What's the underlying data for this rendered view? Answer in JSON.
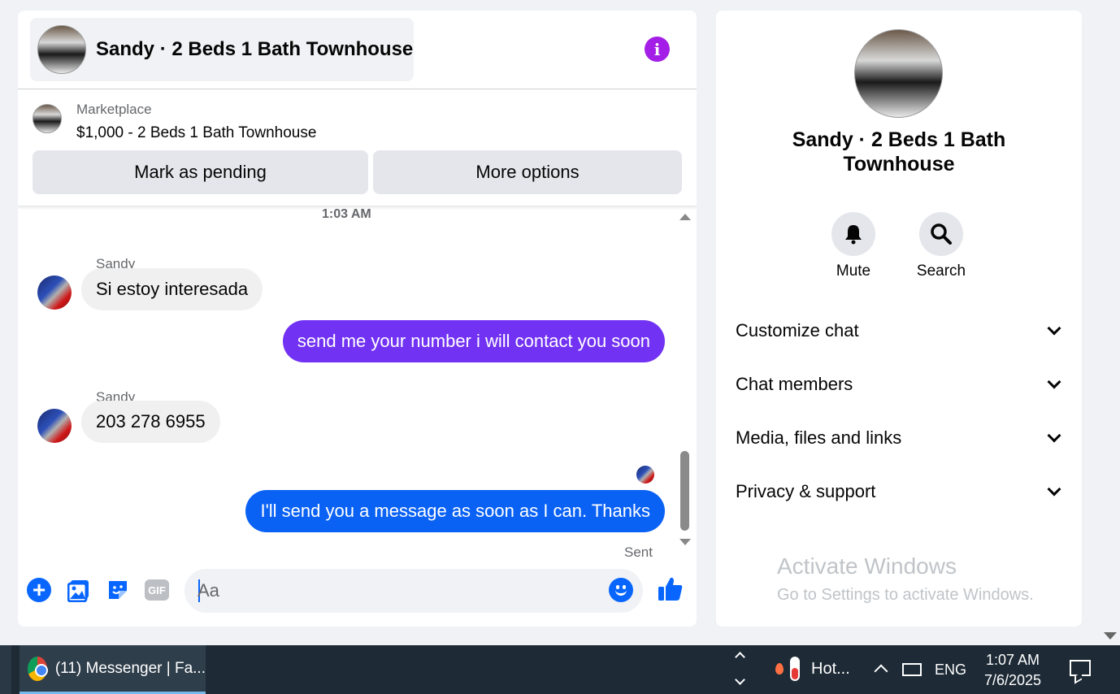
{
  "header": {
    "title": "Sandy · 2 Beds 1 Bath Townhouse",
    "info_glyph": "i"
  },
  "marketplace": {
    "label": "Marketplace",
    "listing": "$1,000 - 2 Beds 1 Bath Townhouse",
    "pending_button": "Mark as pending",
    "more_button": "More options"
  },
  "messages": {
    "timestamp": "1:03 AM",
    "items": [
      {
        "sender": "Sandy",
        "direction": "in",
        "text": "Si estoy interesada"
      },
      {
        "direction": "out",
        "text": "send me your number i will contact you soon",
        "color": "#7232f3"
      },
      {
        "sender": "Sandy",
        "direction": "in",
        "text": "203 278 6955"
      },
      {
        "direction": "out",
        "text": "I'll send you a message as soon as I can. Thanks",
        "color": "#0a62f5"
      }
    ],
    "status": "Sent"
  },
  "composer": {
    "placeholder": "Aa",
    "plus_glyph": "+",
    "gif_label": "GIF"
  },
  "info_panel": {
    "name": "Sandy · 2 Beds 1 Bath Townhouse",
    "actions": [
      {
        "label": "Mute",
        "icon": "bell-icon"
      },
      {
        "label": "Search",
        "icon": "search-icon"
      }
    ],
    "sections": [
      "Customize chat",
      "Chat members",
      "Media, files and links",
      "Privacy & support"
    ]
  },
  "watermark": {
    "title": "Activate Windows",
    "subtitle": "Go to Settings to activate Windows."
  },
  "taskbar": {
    "app_label": "(11) Messenger | Fa...",
    "weather_label": "Hot...",
    "language": "ENG",
    "time": "1:07 AM",
    "date": "7/6/2025"
  },
  "colors": {
    "accent_blue": "#0866ff",
    "accent_purple": "#a31ee6",
    "bubble_purple": "#7232f3",
    "bubble_blue": "#0a62f5"
  }
}
